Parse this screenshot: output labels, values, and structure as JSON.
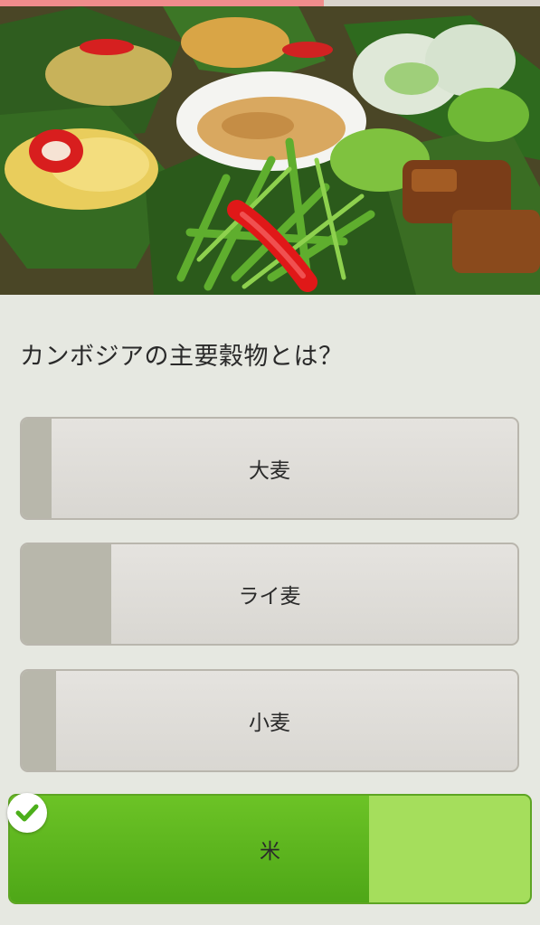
{
  "progress": {
    "fraction": 0.6,
    "color": "#f08c8c"
  },
  "hero_image": {
    "icon": "cambodian-food-platter-photo"
  },
  "question": {
    "text": "カンボジアの主要穀物とは？"
  },
  "answers": [
    {
      "label": "大麦",
      "vote_fraction": 0.06,
      "correct": false
    },
    {
      "label": "ライ麦",
      "vote_fraction": 0.18,
      "correct": false
    },
    {
      "label": "小麦",
      "vote_fraction": 0.07,
      "correct": false
    },
    {
      "label": "米",
      "vote_fraction": 0.69,
      "correct": true
    }
  ],
  "colors": {
    "correct_green": "#5db51f",
    "correct_light": "#a5de5c",
    "wrong_fill": "#b8b7ab",
    "check_green": "#4caf1a"
  },
  "icons": {
    "correct_marker": "checkmark-icon"
  }
}
